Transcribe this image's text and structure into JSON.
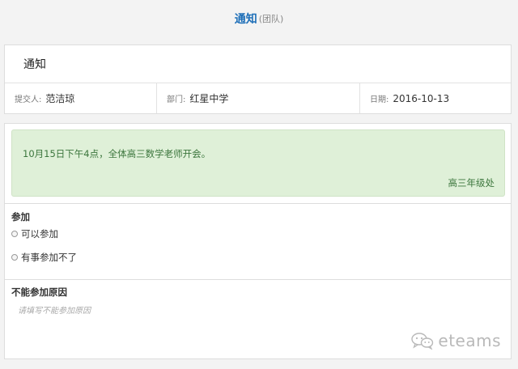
{
  "header": {
    "title": "通知",
    "subtitle": "(团队)"
  },
  "notice_card": {
    "heading": "通知",
    "meta": [
      {
        "label": "提交人:",
        "value": "范洁琼"
      },
      {
        "label": "部门:",
        "value": "红星中学"
      },
      {
        "label": "日期:",
        "value": "2016-10-13"
      }
    ]
  },
  "message": {
    "text": "10月15日下午4点，全体高三数学老师开会。",
    "from": "高三年级处"
  },
  "attend": {
    "label": "参加",
    "options": [
      "可以参加",
      "有事参加不了"
    ]
  },
  "reason": {
    "label": "不能参加原因",
    "placeholder": "请填写不能参加原因"
  },
  "watermark": {
    "icon": "wechat-icon",
    "text": "eteams"
  },
  "colors": {
    "accent": "#1e6fb8",
    "success_bg": "#dff0d8",
    "success_text": "#3c763d"
  }
}
